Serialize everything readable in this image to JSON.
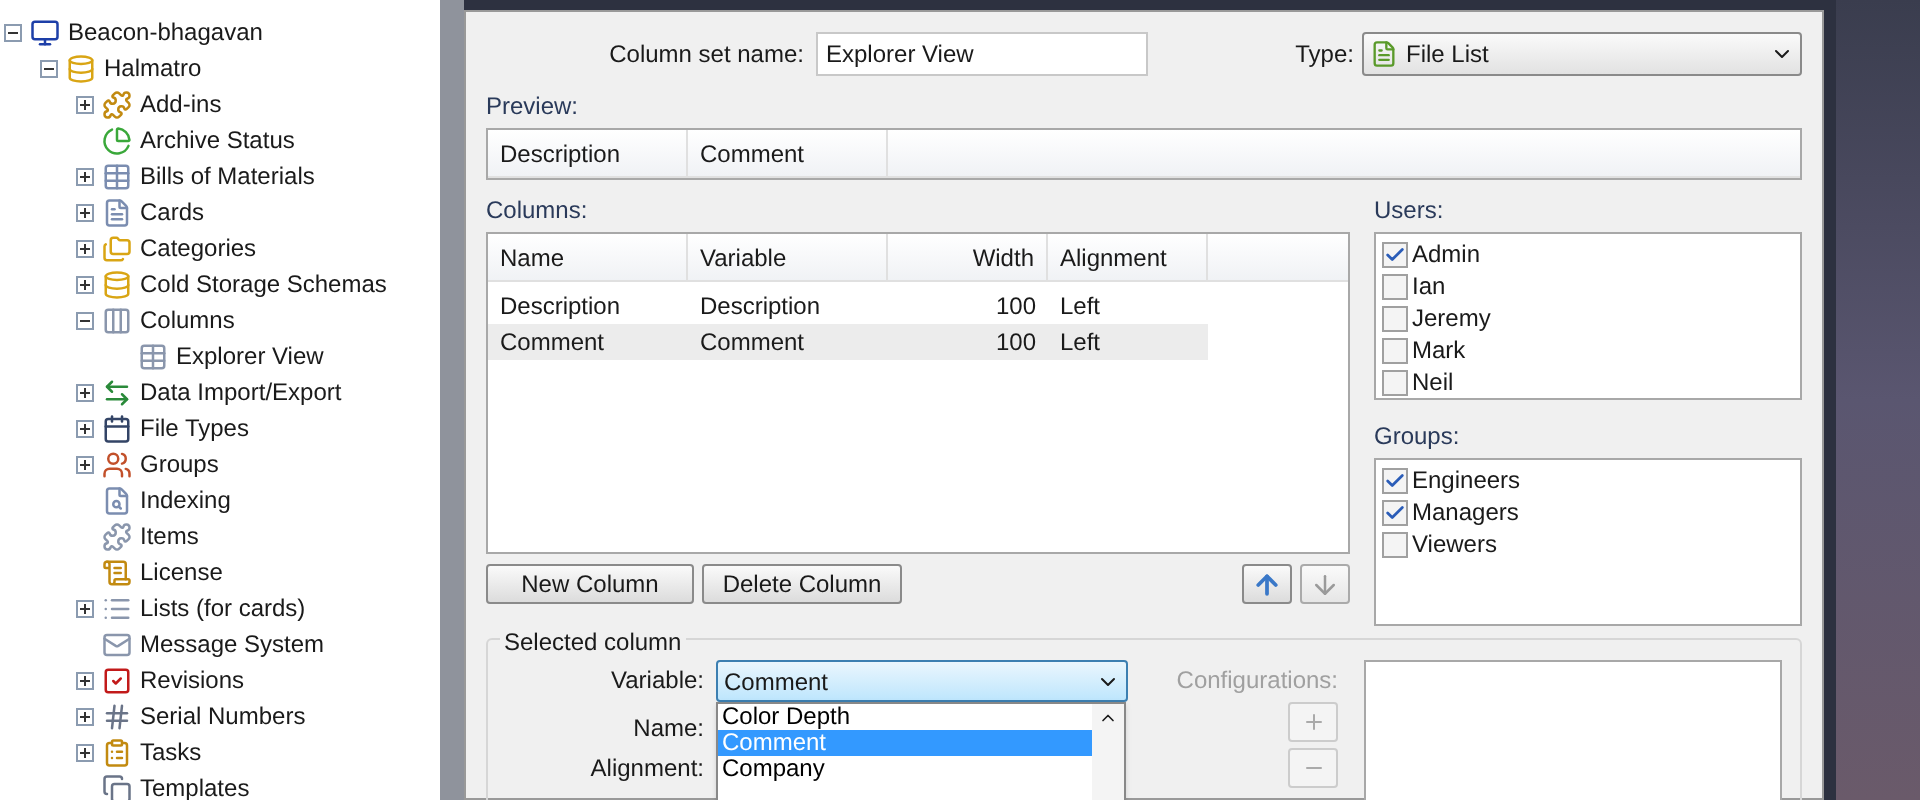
{
  "tree": [
    {
      "label": "Beacon-bhagavan",
      "kind": "branch",
      "expanded": true,
      "children": [
        {
          "label": "Halmatro",
          "kind": "branch",
          "expanded": true,
          "children": [
            {
              "label": "Add-ins",
              "kind": "branch",
              "expanded": false
            },
            {
              "label": "Archive Status",
              "kind": "leaf"
            },
            {
              "label": "Bills of Materials",
              "kind": "branch",
              "expanded": false
            },
            {
              "label": "Cards",
              "kind": "branch",
              "expanded": false
            },
            {
              "label": "Categories",
              "kind": "branch",
              "expanded": false
            },
            {
              "label": "Cold Storage Schemas",
              "kind": "branch",
              "expanded": false
            },
            {
              "label": "Columns",
              "kind": "branch",
              "expanded": true,
              "children": [
                {
                  "label": "Explorer View",
                  "kind": "leaf"
                }
              ]
            },
            {
              "label": "Data Import/Export",
              "kind": "branch",
              "expanded": false
            },
            {
              "label": "File Types",
              "kind": "branch",
              "expanded": false
            },
            {
              "label": "Groups",
              "kind": "branch",
              "expanded": false
            },
            {
              "label": "Indexing",
              "kind": "leaf"
            },
            {
              "label": "Items",
              "kind": "leaf"
            },
            {
              "label": "License",
              "kind": "leaf"
            },
            {
              "label": "Lists (for cards)",
              "kind": "branch",
              "expanded": false
            },
            {
              "label": "Message System",
              "kind": "leaf"
            },
            {
              "label": "Revisions",
              "kind": "branch",
              "expanded": false
            },
            {
              "label": "Serial Numbers",
              "kind": "branch",
              "expanded": false
            },
            {
              "label": "Tasks",
              "kind": "branch",
              "expanded": false
            },
            {
              "label": "Templates",
              "kind": "leaf"
            }
          ]
        }
      ]
    }
  ],
  "dialog": {
    "column_set_name_label": "Column set name:",
    "column_set_name": "Explorer View",
    "type_label": "Type:",
    "type_value": "File List",
    "preview_label": "Preview:",
    "preview_columns": [
      "Description",
      "Comment"
    ],
    "columns_label": "Columns:",
    "columns_headers": [
      "Name",
      "Variable",
      "Width",
      "Alignment"
    ],
    "columns_rows": [
      {
        "cells": [
          "Description",
          "Description",
          "100",
          "Left"
        ],
        "selected": false
      },
      {
        "cells": [
          "Comment",
          "Comment",
          "100",
          "Left"
        ],
        "selected": true
      }
    ],
    "new_column": "New Column",
    "delete_column": "Delete Column",
    "users_label": "Users:",
    "users": [
      {
        "label": "Admin",
        "checked": true
      },
      {
        "label": "Ian",
        "checked": false
      },
      {
        "label": "Jeremy",
        "checked": false
      },
      {
        "label": "Mark",
        "checked": false
      },
      {
        "label": "Neil",
        "checked": false
      }
    ],
    "groups_label": "Groups:",
    "groups": [
      {
        "label": "Engineers",
        "checked": true
      },
      {
        "label": "Managers",
        "checked": true
      },
      {
        "label": "Viewers",
        "checked": false
      }
    ],
    "selected_column_label": "Selected column",
    "variable_label": "Variable:",
    "variable_value": "Comment",
    "variable_options": [
      {
        "label": "Color Depth",
        "selected": false
      },
      {
        "label": "Comment",
        "selected": true
      },
      {
        "label": "Company",
        "selected": false
      }
    ],
    "name_label": "Name:",
    "alignment_label": "Alignment:",
    "configurations_label": "Configurations:"
  }
}
